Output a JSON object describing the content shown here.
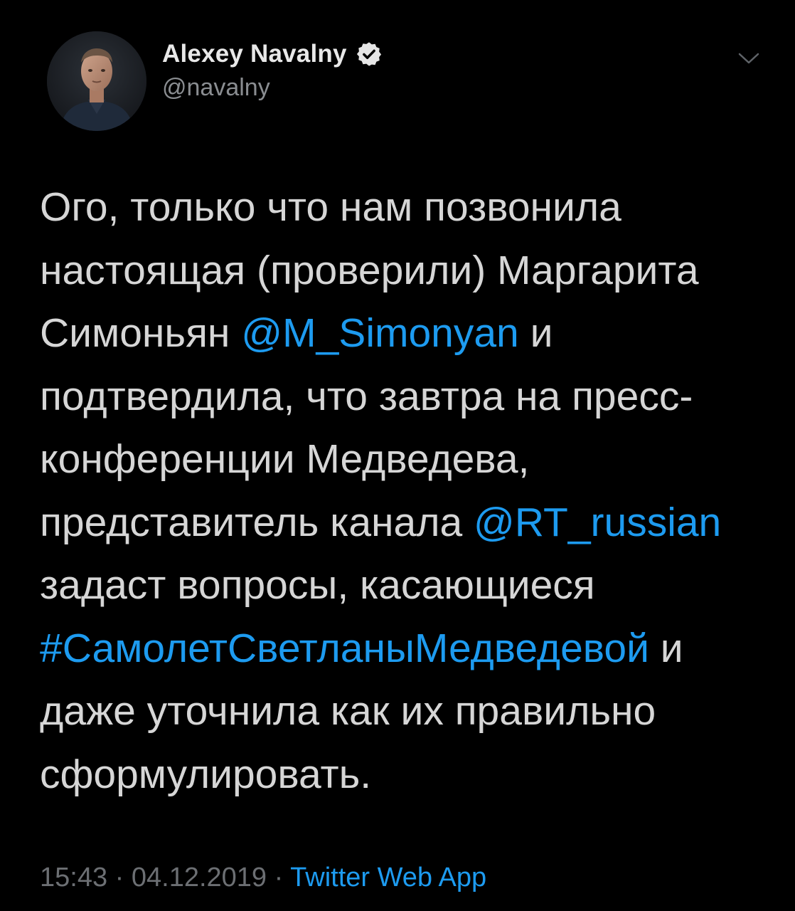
{
  "author": {
    "display_name": "Alexey Navalny",
    "handle": "@navalny",
    "verified": true
  },
  "tweet": {
    "lines": [
      [
        {
          "text": "Ого, только что нам позвонила",
          "type": "text"
        }
      ],
      [
        {
          "text": "настоящая (проверили) Маргарита",
          "type": "text"
        }
      ],
      [
        {
          "text": "Симоньян ",
          "type": "text"
        },
        {
          "text": "@M_Simonyan",
          "type": "mention"
        },
        {
          "text": " и",
          "type": "text"
        }
      ],
      [
        {
          "text": "подтвердила, что завтра на пресс-",
          "type": "text"
        }
      ],
      [
        {
          "text": "конференции Медведева,",
          "type": "text"
        }
      ],
      [
        {
          "text": "представитель канала ",
          "type": "text"
        },
        {
          "text": "@RT_russian",
          "type": "mention"
        }
      ],
      [
        {
          "text": "задаст вопросы, касающиеся",
          "type": "text"
        }
      ],
      [
        {
          "text": "#СамолетСветланыМедведевой",
          "type": "hashtag"
        },
        {
          "text": " и",
          "type": "text"
        }
      ],
      [
        {
          "text": "даже уточнила как их правильно",
          "type": "text"
        }
      ],
      [
        {
          "text": "сформулировать.",
          "type": "text"
        }
      ]
    ]
  },
  "meta": {
    "time": "15:43",
    "separator": " · ",
    "date": "04.12.2019",
    "source": "Twitter Web App"
  },
  "icons": {
    "verified": "verified-badge-icon",
    "menu": "chevron-down-icon"
  },
  "colors": {
    "background": "#000000",
    "link": "#1d9bf0",
    "muted": "#6c6f73",
    "text": "#d6d6d6"
  }
}
